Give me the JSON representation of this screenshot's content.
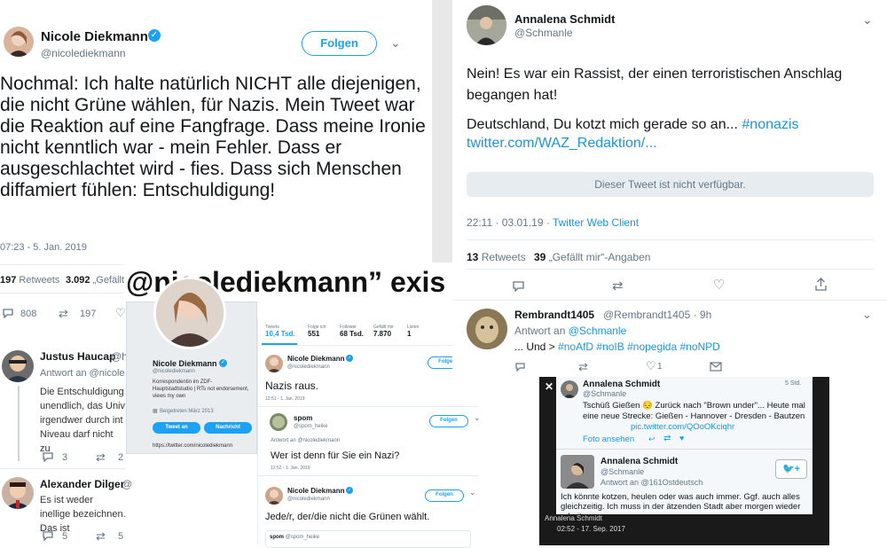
{
  "left_tweet": {
    "name": "Nicole Diekmann",
    "handle": "@nicolediekmann",
    "follow_label": "Folgen",
    "text": "Nochmal: Ich halte natürlich NICHT alle diejenigen, die nicht Grüne wählen, für Nazis. Mein Tweet war die Reaktion auf eine Fangfrage. Dass meine Ironie nicht kenntlich war - mein Fehler. Dass er ausgeschlachtet wird - fies. Dass sich Menschen diffamiert fühlen: Entschuldigung!",
    "timestamp": "07:23 - 5. Jan. 2019",
    "retweets_count": "197",
    "retweets_label": "Retweets",
    "likes_count": "3.092",
    "likes_label": "„Gefällt",
    "reply_count": "808",
    "rt_count": "197"
  },
  "replies": [
    {
      "name": "Justus Haucap",
      "handle": "@h",
      "reply_to": "Antwort an @nicole",
      "text": "Die Entschuldigung unendlich, das Univ irgendwer durch int Niveau darf nicht zu",
      "reply_count": "3",
      "rt_count": "2"
    },
    {
      "name": "Alexander Dilger",
      "handle": "@",
      "text": "Es ist weder inellige bezeichnen. Das ist",
      "reply_count": "5",
      "rt_count": "5"
    }
  ],
  "overlay_caption": "@nicolediekmann” exis",
  "profile_card": {
    "name": "Nicole Diekmann",
    "handle": "@nicolediekmann",
    "bio": "Korrespondentin im ZDF-Hauptstadtstudio | RTs not endorsement, views my own",
    "joined": "Beigetreten März 2013",
    "tweet_button": "Tweet an",
    "message_button": "Nachricht",
    "url": "https://twitter.com/nicolediekmann",
    "stats": [
      {
        "label": "Tweets",
        "value": "10,4 Tsd."
      },
      {
        "label": "Folge ich",
        "value": "551"
      },
      {
        "label": "Follower",
        "value": "68 Tsd."
      },
      {
        "label": "Gefällt mir",
        "value": "7.870"
      },
      {
        "label": "Listen",
        "value": "1"
      }
    ]
  },
  "thread": [
    {
      "name": "Nicole Diekmann",
      "handle": "@nicolediekmann",
      "text": "Nazis raus.",
      "time": "12:51 - 1. Jan. 2019",
      "follow": "Folgen"
    },
    {
      "name": "spom",
      "handle": "@spom_heike",
      "reply_to": "Antwort an @nicolediekmann",
      "text": "Wer ist denn für Sie ein Nazi?",
      "time": "12:52 - 1. Jan. 2019",
      "follow": "Folgen"
    },
    {
      "name": "Nicole Diekmann",
      "handle": "@nicolediekmann",
      "text": "Jede/r, der/die nicht die Grünen wählt.",
      "follow": "Folgen"
    },
    {
      "name": "spom",
      "handle": "@spom_heike"
    }
  ],
  "right_tweet": {
    "name": "Annalena Schmidt",
    "handle": "@Schmanle",
    "text1": "Nein! Es war ein Rassist, der einen terroristischen Anschlag begangen hat!",
    "text2": "Deutschland, Du kotzt mich gerade so an...",
    "hashtag": "#nonazis",
    "link": "twitter.com/WAZ_Redaktion/...",
    "unavailable": "Dieser Tweet ist nicht verfügbar.",
    "time": "22:11 · 03.01.19 ·",
    "client": "Twitter Web Client",
    "retweets_count": "13",
    "retweets_label": "Retweets",
    "likes_count": "39",
    "likes_label": "„Gefällt mir“-Angaben"
  },
  "right_reply": {
    "name": "Rembrandt1405",
    "handle": "@Rembrandt1405 · 9h",
    "reply_to_label": "Antwort an",
    "reply_to": "@Schmanle",
    "text_prefix": "... Und >",
    "hashtags": "#noAfD #noIB #nopegida #noNPD",
    "like_count": "1"
  },
  "dark_panel": {
    "close": "✕",
    "top_name": "Annalena Schmidt",
    "top_handle": "@Schmanle",
    "top_time": "5 Std.",
    "top_text": "Tschüß Gießen 😔 Zurück nach \"Brown under\"... Heute mal eine neue Strecke: Gießen - Hannover - Dresden - Bautzen",
    "top_link": "pic.twitter.com/QOoOKciqhr",
    "photo_label": "Foto ansehen",
    "bottom_name": "Annalena Schmidt",
    "bottom_handle": "@Schmanle",
    "bottom_reply": "Antwort an @161Ostdeutsch",
    "bottom_text": "Ich könnte kotzen, heulen oder was auch immer. Ggf. auch alles gleichzeitig. Ich muss in der ätzenden Stadt aber morgen wieder arbeiten...",
    "footer_name": "Annalena Schmidt",
    "footer_time": "02:52 - 17. Sep. 2017"
  }
}
